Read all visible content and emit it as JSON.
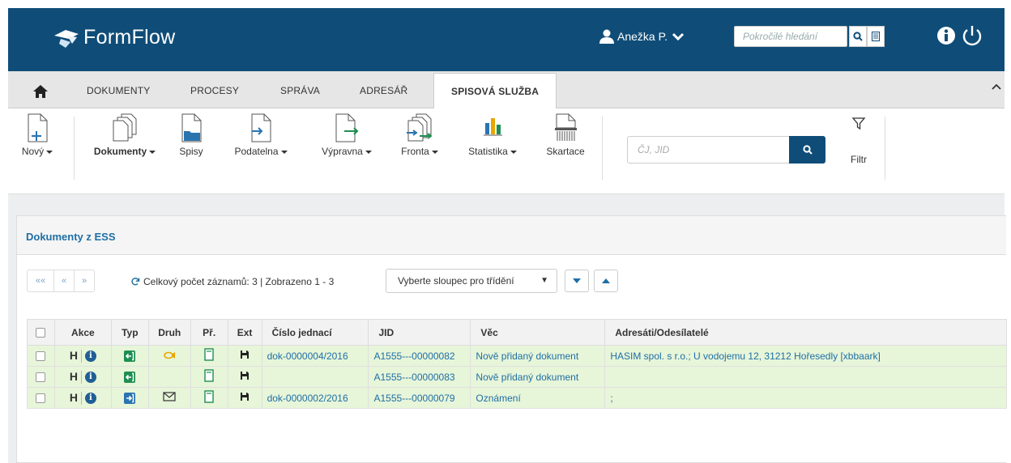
{
  "header": {
    "brand": "FormFlow",
    "user_name": "Anežka P.",
    "search_placeholder": "Pokročilé hledání"
  },
  "menu": {
    "items": [
      "DOKUMENTY",
      "PROCESY",
      "SPRÁVA",
      "ADRESÁŘ"
    ],
    "active": "SPISOVÁ SLUŽBA"
  },
  "toolbar": {
    "new": "Nový",
    "documents": "Dokumenty",
    "files": "Spisy",
    "intake": "Podatelna",
    "dispatch": "Výpravna",
    "queue": "Fronta",
    "stats": "Statistika",
    "shredding": "Skartace",
    "search_placeholder": "ČJ, JID",
    "filter": "Filtr"
  },
  "panel": {
    "title": "Dokumenty z ESS",
    "pager": [
      "««",
      "«",
      "»"
    ],
    "count_text": "Celkový počet záznamů: 3 | Zobrazeno 1 - 3",
    "sort_placeholder": "Vyberte sloupec pro třídění",
    "sort_arrow": "▼"
  },
  "table": {
    "columns": [
      "Akce",
      "Typ",
      "Druh",
      "Př.",
      "Ext",
      "Číslo jednací",
      "JID",
      "Věc",
      "Adresáti/Odesílatelé"
    ],
    "rows": [
      {
        "action": "H",
        "info": "i",
        "type": "in",
        "kind": "post",
        "cj": "dok-0000004/2016",
        "jid": "A1555---00000082",
        "subject": "Nově přidaný dokument",
        "addr": "HASIM spol. s r.o.; U vodojemu 12, 31212 Hořesedly [xbbaark]"
      },
      {
        "action": "H",
        "info": "i",
        "type": "in",
        "kind": "",
        "cj": "",
        "jid": "A1555---00000083",
        "subject": "Nově přidaný dokument",
        "addr": ""
      },
      {
        "action": "H",
        "info": "i",
        "type": "out",
        "kind": "envelope",
        "cj": "dok-0000002/2016",
        "jid": "A1555---00000079",
        "subject": "Oznámení",
        "addr": ";"
      }
    ]
  },
  "colors": {
    "header_bg": "#0f4d78",
    "row_bg": "#e7f5d9",
    "link": "#1f6fa5",
    "type_in": "#1e8e52",
    "type_out": "#2a74b0"
  }
}
